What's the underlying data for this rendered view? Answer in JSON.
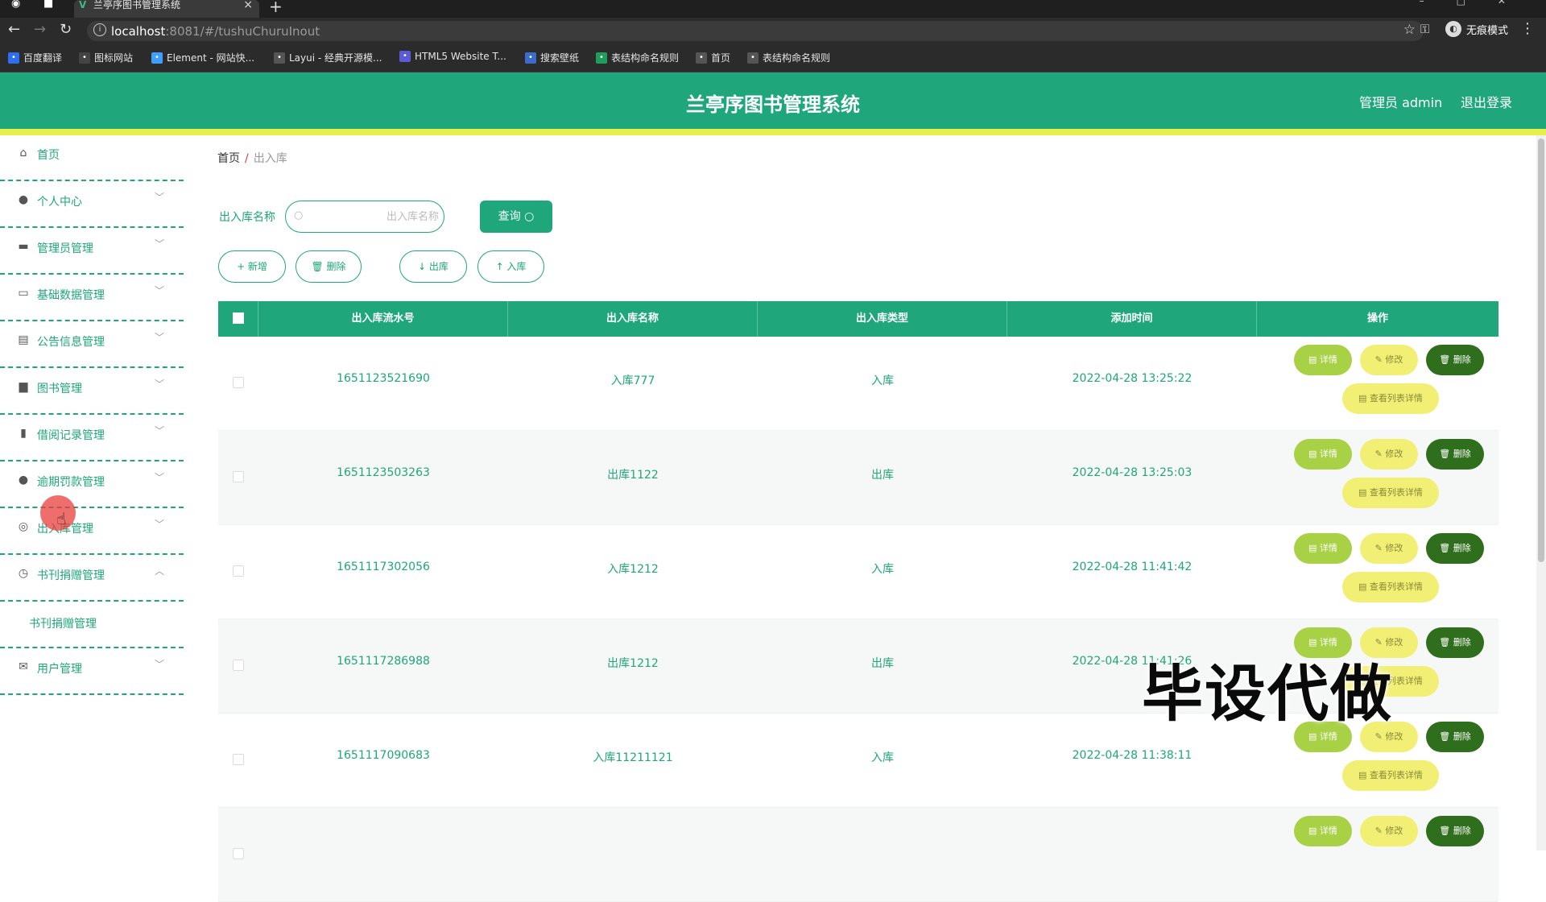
{
  "browser": {
    "tab_title": "兰亭序图书管理系统",
    "url_host": "localhost",
    "url_rest": ":8081/#/tushuChuruInout",
    "incognito_label": "无痕模式",
    "bookmarks": [
      {
        "label": "百度翻译",
        "color": "#2d6ff0"
      },
      {
        "label": "图标网站",
        "color": "#444444"
      },
      {
        "label": "Element - 网站快...",
        "color": "#409eff"
      },
      {
        "label": "Layui - 经典开源模...",
        "color": "#555555"
      },
      {
        "label": "HTML5 Website T...",
        "color": "#5b5bd6"
      },
      {
        "label": "搜索壁纸",
        "color": "#3c6cc7"
      },
      {
        "label": "表结构命名规则",
        "color": "#1e9e5a"
      },
      {
        "label": "首页",
        "color": "#555555"
      },
      {
        "label": "表结构命名规则",
        "color": "#555555"
      }
    ]
  },
  "header": {
    "title": "兰亭序图书管理系统",
    "admin": "管理员 admin",
    "logout": "退出登录"
  },
  "sidebar": {
    "items": [
      {
        "label": "首页",
        "icon": "home-icon",
        "glyph": "⌂"
      },
      {
        "label": "个人中心",
        "icon": "user-icon",
        "glyph": "●"
      },
      {
        "label": "管理员管理",
        "icon": "monitor-icon",
        "glyph": "▬"
      },
      {
        "label": "基础数据管理",
        "icon": "chat-icon",
        "glyph": "▭"
      },
      {
        "label": "公告信息管理",
        "icon": "clipboard-icon",
        "glyph": "▤"
      },
      {
        "label": "图书管理",
        "icon": "message-icon",
        "glyph": "▆"
      },
      {
        "label": "借阅记录管理",
        "icon": "bottle-icon",
        "glyph": "▮"
      },
      {
        "label": "逾期罚款管理",
        "icon": "balloon-icon",
        "glyph": "●"
      },
      {
        "label": "出入库管理",
        "icon": "compass-icon",
        "glyph": "◎"
      },
      {
        "label": "书刊捐赠管理",
        "icon": "clock-icon",
        "glyph": "◷"
      }
    ],
    "sub_item": "书刊捐赠管理",
    "last_item": {
      "label": "用户管理",
      "icon": "mail-icon",
      "glyph": "✉"
    }
  },
  "breadcrumb": {
    "home": "首页",
    "sep": "/",
    "current": "出入库"
  },
  "search": {
    "label": "出入库名称",
    "placeholder": "出入库名称",
    "query_button": "查询 ○"
  },
  "actions": {
    "add": "+ 新增",
    "delete": "🗑 删除",
    "out": "↓ 出库",
    "in": "↑ 入库"
  },
  "table": {
    "columns": [
      "出入库流水号",
      "出入库名称",
      "出入库类型",
      "添加时间",
      "操作"
    ],
    "rows": [
      {
        "serial": "1651123521690",
        "name": "入库777",
        "type": "入库",
        "time": "2022-04-28 13:25:22"
      },
      {
        "serial": "1651123503263",
        "name": "出库1122",
        "type": "出库",
        "time": "2022-04-28 13:25:03"
      },
      {
        "serial": "1651117302056",
        "name": "入库1212",
        "type": "入库",
        "time": "2022-04-28 11:41:42"
      },
      {
        "serial": "1651117286988",
        "name": "出库1212",
        "type": "出库",
        "time": "2022-04-28 11:41:26"
      },
      {
        "serial": "1651117090683",
        "name": "入库11211121",
        "type": "入库",
        "time": "2022-04-28 11:38:11"
      },
      {
        "serial": "",
        "name": "",
        "type": "",
        "time": ""
      }
    ],
    "row_buttons": {
      "detail": "▤ 详情",
      "edit": "✎ 修改",
      "delete": "🗑 删除",
      "list_detail": "▤ 查看列表详情"
    }
  },
  "watermark": "毕设代做"
}
